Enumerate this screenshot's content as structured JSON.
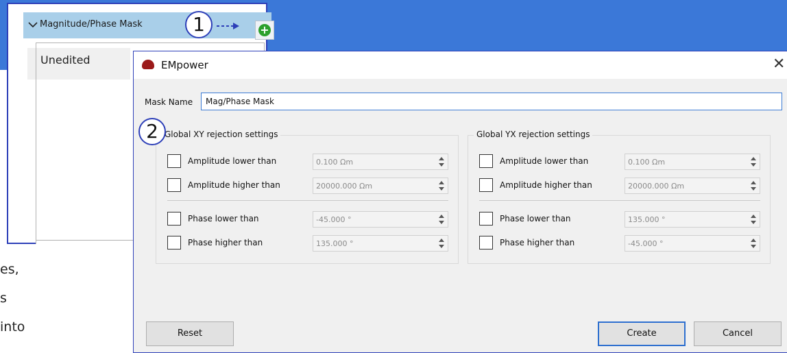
{
  "tree": {
    "item_label": "Magnitude/Phase Mask",
    "child_label": "Unedited"
  },
  "background_text": [
    "es,",
    "s",
    "into"
  ],
  "callouts": [
    "1",
    "2"
  ],
  "dialog": {
    "title": "EMpower",
    "mask_name_label": "Mask Name",
    "mask_name_value": "Mag/Phase Mask",
    "groups": [
      {
        "title": "Global XY rejection settings",
        "rows": [
          {
            "label": "Amplitude lower than",
            "value": "0.100 Ωm"
          },
          {
            "label": "Amplitude higher than",
            "value": "20000.000 Ωm"
          },
          {
            "label": "Phase lower than",
            "value": "-45.000 °"
          },
          {
            "label": "Phase higher than",
            "value": "135.000 °"
          }
        ]
      },
      {
        "title": "Global YX rejection settings",
        "rows": [
          {
            "label": "Amplitude lower than",
            "value": "0.100 Ωm"
          },
          {
            "label": "Amplitude higher than",
            "value": "20000.000 Ωm"
          },
          {
            "label": "Phase lower than",
            "value": "135.000 °"
          },
          {
            "label": "Phase higher than",
            "value": "-45.000 °"
          }
        ]
      }
    ],
    "buttons": {
      "reset": "Reset",
      "create": "Create",
      "cancel": "Cancel"
    }
  },
  "colors": {
    "accent": "#3b78d8",
    "selection": "#a9cfe9",
    "callout_border": "#2d3fb8"
  }
}
